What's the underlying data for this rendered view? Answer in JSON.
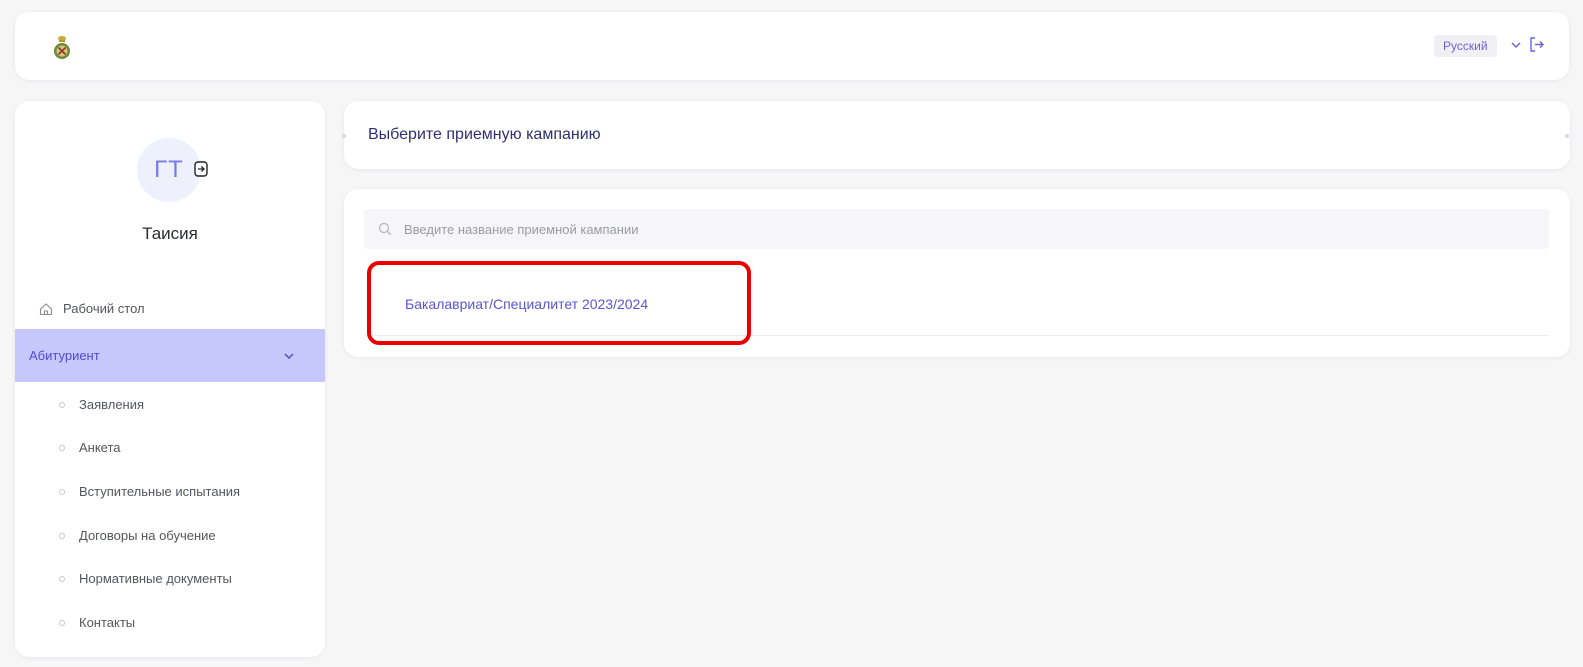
{
  "header": {
    "language": "Русский"
  },
  "sidebar": {
    "avatar_initials": "ГТ",
    "user_name": "Таисия",
    "home_label": "Рабочий стол",
    "active_section": "Абитуриент",
    "sub_items": [
      {
        "label": "Заявления"
      },
      {
        "label": "Анкета"
      },
      {
        "label": "Вступительные испытания"
      },
      {
        "label": "Договоры на обучение"
      },
      {
        "label": "Нормативные документы"
      },
      {
        "label": "Контакты"
      }
    ]
  },
  "main": {
    "title": "Выберите приемную кампанию",
    "search_placeholder": "Введите название приемной кампании",
    "campaigns": [
      {
        "label": "Бакалавриат/Специалитет 2023/2024"
      }
    ]
  },
  "colors": {
    "accent": "#5b55d6",
    "active_nav_bg": "#c6c8fb",
    "highlight": "#ea0000"
  }
}
